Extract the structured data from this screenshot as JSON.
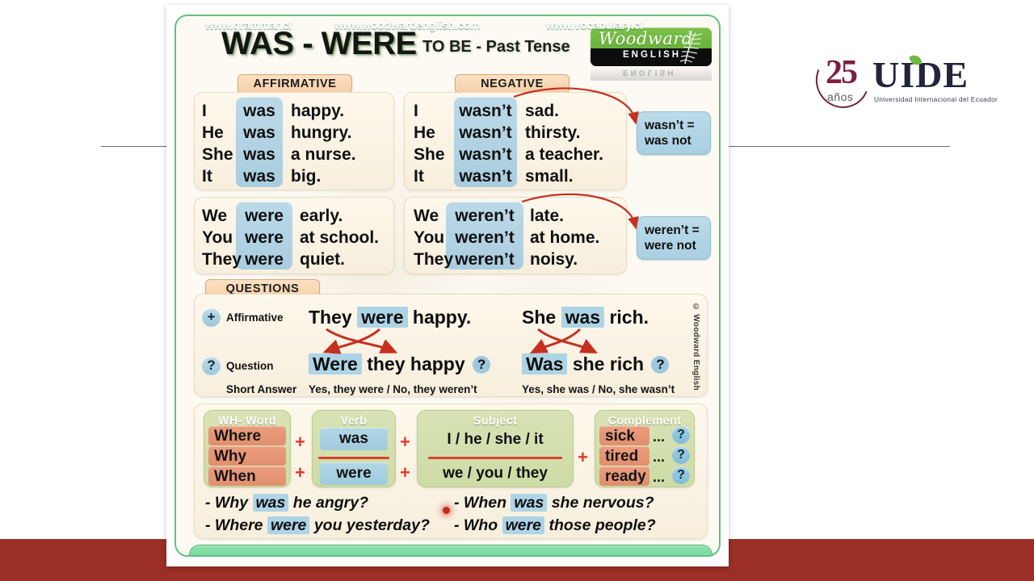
{
  "header": {
    "title": "WAS - WERE",
    "subtitle": "TO BE - Past Tense",
    "logo": {
      "word": "Woodward",
      "english": "ENGLISH"
    }
  },
  "brand": {
    "number": "25",
    "years": "años",
    "name": "UIDE",
    "tagline": "Universidad Internacional del Ecuador"
  },
  "labels": {
    "affirmative": "AFFIRMATIVE",
    "negative": "NEGATIVE",
    "questions": "QUESTIONS"
  },
  "affirmative": {
    "singular": [
      {
        "pronoun": "I",
        "verb": "was",
        "complement": "happy."
      },
      {
        "pronoun": "He",
        "verb": "was",
        "complement": "hungry."
      },
      {
        "pronoun": "She",
        "verb": "was",
        "complement": "a nurse."
      },
      {
        "pronoun": "It",
        "verb": "was",
        "complement": "big."
      }
    ],
    "plural": [
      {
        "pronoun": "We",
        "verb": "were",
        "complement": "early."
      },
      {
        "pronoun": "You",
        "verb": "were",
        "complement": "at school."
      },
      {
        "pronoun": "They",
        "verb": "were",
        "complement": "quiet."
      }
    ]
  },
  "negative": {
    "singular": [
      {
        "pronoun": "I",
        "verb": "wasn’t",
        "complement": "sad."
      },
      {
        "pronoun": "He",
        "verb": "wasn’t",
        "complement": "thirsty."
      },
      {
        "pronoun": "She",
        "verb": "wasn’t",
        "complement": "a teacher."
      },
      {
        "pronoun": "It",
        "verb": "wasn’t",
        "complement": "small."
      }
    ],
    "plural": [
      {
        "pronoun": "We",
        "verb": "weren’t",
        "complement": "late."
      },
      {
        "pronoun": "You",
        "verb": "weren’t",
        "complement": "at home."
      },
      {
        "pronoun": "They",
        "verb": "weren’t",
        "complement": "noisy."
      }
    ],
    "contractions": [
      {
        "line1": "wasn’t =",
        "line2": "was not"
      },
      {
        "line1": "weren’t =",
        "line2": "were not"
      }
    ]
  },
  "questions": {
    "row_labels": {
      "affirmative": "Affirmative",
      "question": "Question",
      "short_answer": "Short Answer"
    },
    "badges": {
      "affirmative": "+",
      "question": "?"
    },
    "examples": [
      {
        "affirmative_pre": "They",
        "affirmative_verb": "were",
        "affirmative_post": "happy.",
        "question_verb": "Were",
        "question_post": "they happy",
        "question_mark": "?",
        "short_answer": "Yes, they were / No, they weren’t"
      },
      {
        "affirmative_pre": "She",
        "affirmative_verb": "was",
        "affirmative_post": "rich.",
        "question_verb": "Was",
        "question_post": "she rich",
        "question_mark": "?",
        "short_answer": "Yes, she was / No, she wasn’t"
      }
    ],
    "copyright": "© Woodward English"
  },
  "formula": {
    "columns": [
      {
        "heading": "WH- Word",
        "cells": [
          "Where",
          "Why",
          "When"
        ]
      },
      {
        "heading": "Verb",
        "cells": [
          "was",
          "were"
        ]
      },
      {
        "heading": "Subject",
        "cells": [
          "I / he / she / it",
          "we / you / they"
        ]
      },
      {
        "heading": "Complement",
        "cells": [
          "sick",
          "tired",
          "ready"
        ]
      }
    ],
    "plus": "+",
    "dots": "...",
    "question_mark": "?"
  },
  "sentences": [
    {
      "dash": "-",
      "pre": "Why",
      "verb": "was",
      "post": "he angry?"
    },
    {
      "dash": "-",
      "pre": "Where",
      "verb": "were",
      "post": "you yesterday?"
    },
    {
      "dash": "-",
      "pre": "When",
      "verb": "was",
      "post": "she nervous?"
    },
    {
      "dash": "-",
      "pre": "Who",
      "verb": "were",
      "post": "those people?"
    }
  ],
  "footer": {
    "urls": [
      "www.grammar.cl",
      "www.woodwardenglish.com",
      "www.vocabulary.cl"
    ]
  },
  "colors": {
    "card_border": "#63c07e",
    "pill": "#f6d0a8",
    "verb_chip": "#a9cddf",
    "panel_green": "#cddba5",
    "cell_salmon": "#e08f6e",
    "accent_red": "#d9432c",
    "bottom_bar": "#9c3028",
    "footer_green": "#6ed694"
  }
}
